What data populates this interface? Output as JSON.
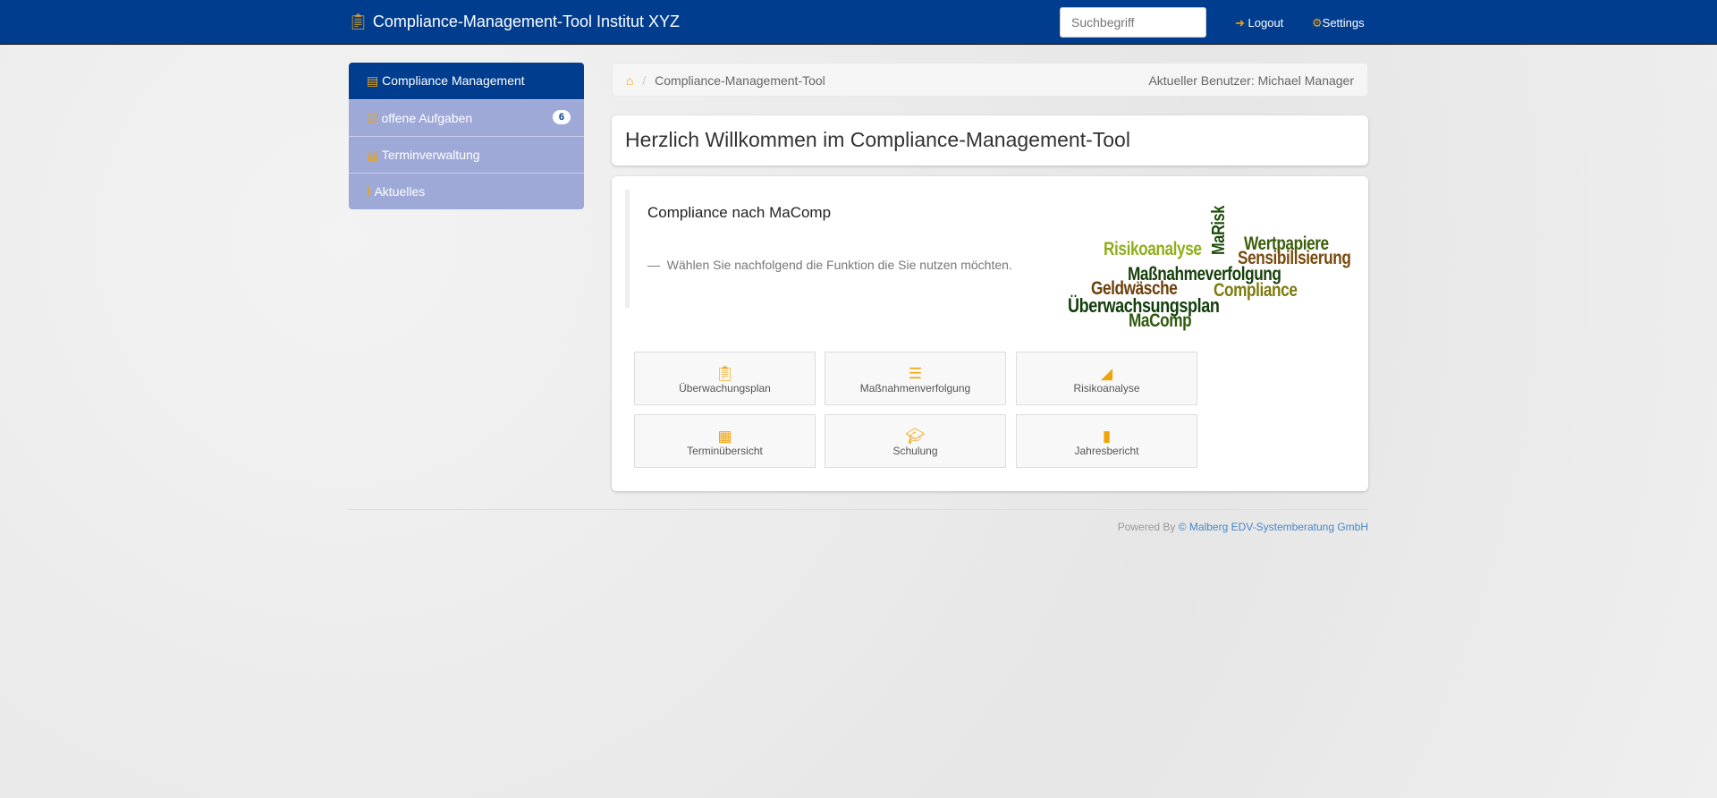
{
  "navbar": {
    "brand": "Compliance-Management-Tool Institut XYZ",
    "brand_icon": "clipboard-icon",
    "search_placeholder": "Suchbegriff",
    "logout": "Logout",
    "settings": "Settings"
  },
  "sidebar": {
    "items": [
      {
        "label": "Compliance Management",
        "icon": "clipboard-icon",
        "active": true
      },
      {
        "label": "offene Aufgaben",
        "icon": "check-square-icon",
        "badge": "6"
      },
      {
        "label": "Terminverwaltung",
        "icon": "calendar-icon"
      },
      {
        "label": "Aktuelles",
        "icon": "info-icon"
      }
    ]
  },
  "breadcrumb": {
    "home_icon": "home-icon",
    "current": "Compliance-Management-Tool",
    "user": "Aktueller Benutzer: Michael Manager"
  },
  "welcome": {
    "title": "Herzlich Willkommen im Compliance-Management-Tool"
  },
  "intro": {
    "heading": "Compliance nach MaComp",
    "text": "Wählen Sie nachfolgend die Funktion die Sie nutzen möchten.",
    "dash": "—"
  },
  "wordcloud": [
    "Risikoanalyse",
    "MaRisk",
    "Wertpapiere",
    "Sensibilisierung",
    "Maßnahmeverfolgung",
    "Geldwäsche",
    "Compliance",
    "Überwachsungsplan",
    "MaComp"
  ],
  "tiles": [
    {
      "label": "Überwachungsplan",
      "icon": "clipboard-icon"
    },
    {
      "label": "Maßnahmenverfolgung",
      "icon": "tasks-icon"
    },
    {
      "label": "Risikoanalyse",
      "icon": "area-chart-icon"
    },
    {
      "label": "Terminübersicht",
      "icon": "calendar-icon"
    },
    {
      "label": "Schulung",
      "icon": "graduation-cap-icon"
    },
    {
      "label": "Jahresbericht",
      "icon": "book-icon"
    }
  ],
  "footer": {
    "prefix": "Powered By",
    "link": "© Malberg EDV-Systemberatung GmbH"
  },
  "colors": {
    "navbar": "#003d8f",
    "accent": "#f0a30a",
    "sidebar": "#9ea9d8"
  }
}
